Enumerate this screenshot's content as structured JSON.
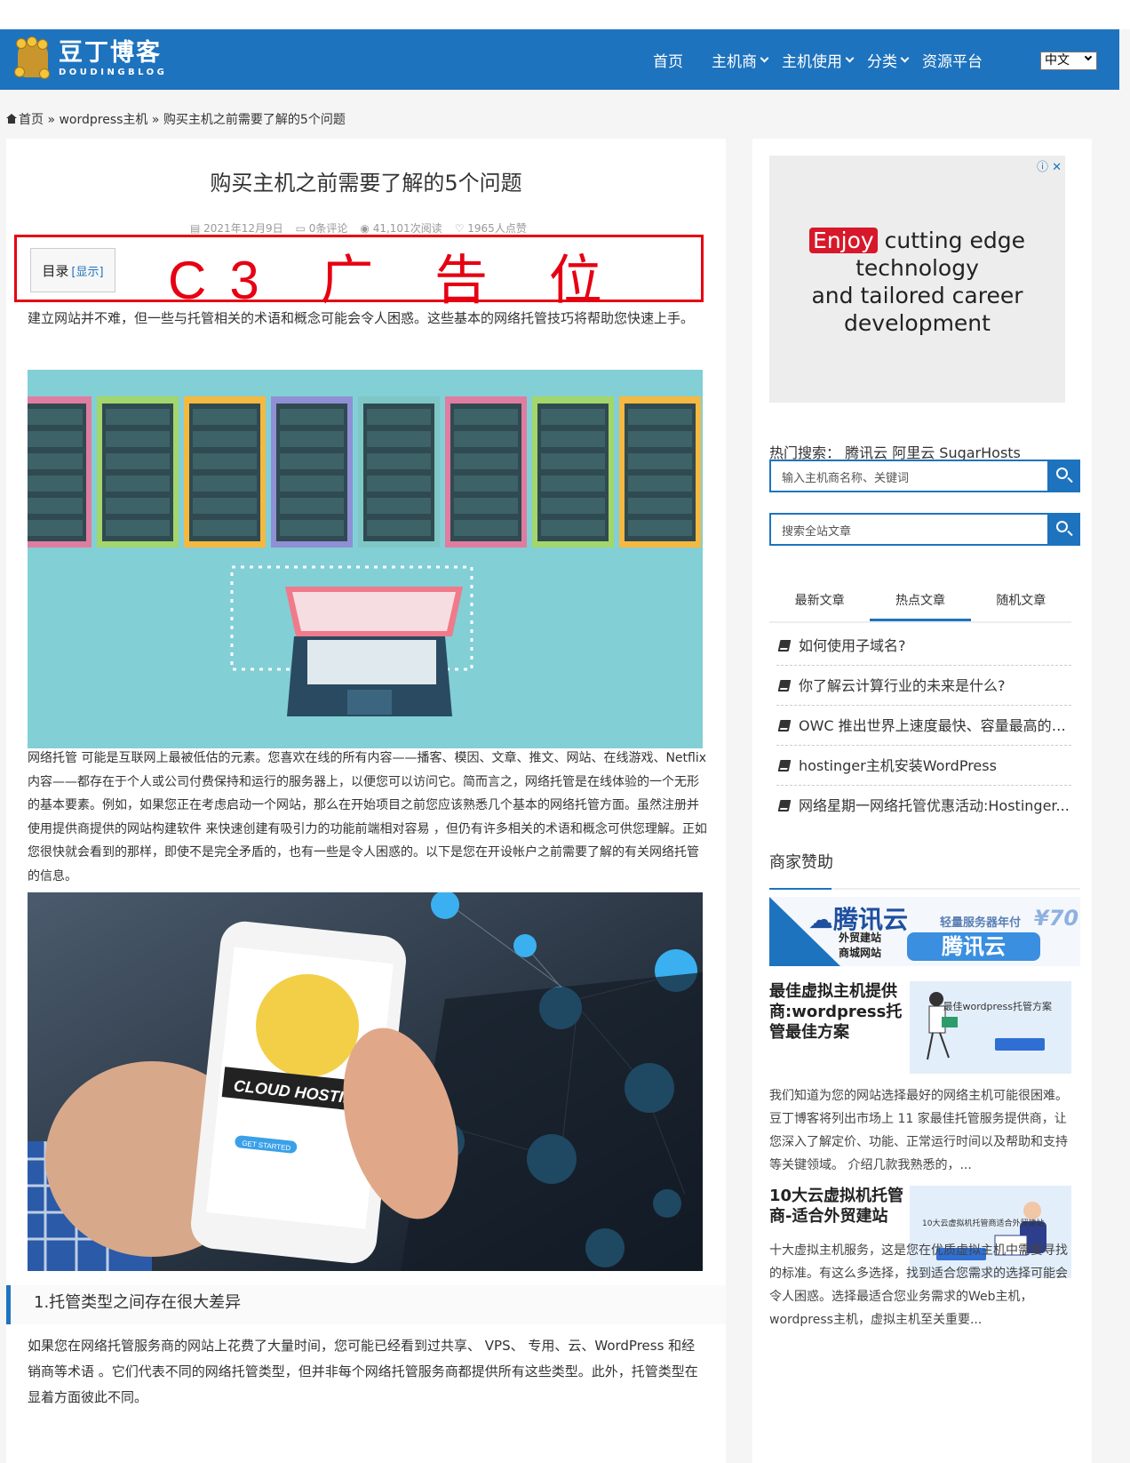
{
  "header": {
    "logo_title": "豆丁博客",
    "logo_sub": "DOUDINGBLOG",
    "nav": [
      {
        "label": "首页",
        "dropdown": false
      },
      {
        "label": "主机商",
        "dropdown": true
      },
      {
        "label": "主机使用",
        "dropdown": true
      },
      {
        "label": "分类",
        "dropdown": true
      },
      {
        "label": "资源平台",
        "dropdown": false
      }
    ],
    "language_selected": "中文"
  },
  "breadcrumb": {
    "home": "首页",
    "sep1": "»",
    "category": "wordpress主机",
    "sep2": "»",
    "current": "购买主机之前需要了解的5个问题"
  },
  "article": {
    "title": "购买主机之前需要了解的5个问题",
    "meta": {
      "date": "2021年12月9日",
      "comments": "0条评论",
      "views": "41,101次阅读",
      "likes": "1965人点赞"
    },
    "toc_label": "目录",
    "toc_toggle": "[显示]",
    "ad_label": "C3 广 告 位",
    "intro": "建立网站并不难，但一些与托管相关的术语和概念可能会令人困惑。这些基本的网络托管技巧将帮助您快速上手。",
    "body_paragraph": "网络托管 可能是互联网上最被低估的元素。您喜欢在线的所有内容——播客、模因、文章、推文、网站、在线游戏、Netflix内容——都存在于个人或公司付费保持和运行的服务器上，以便您可以访问它。简而言之，网络托管是在线体验的一个无形的基本要素。例如，如果您正在考虑启动一个网站，那么在开始项目之前您应该熟悉几个基本的网络托管方面。虽然注册并使用提供商提供的网站构建软件 来快速创建有吸引力的功能前端相对容易 ，但仍有许多相关的术语和概念可供您理解。正如您很快就会看到的那样，即使不是完全矛盾的，也有一些是令人困惑的。以下是您在开设帐户之前需要了解的有关网络托管的信息。",
    "cloud_image_text": "CLOUD HOSTING",
    "cloud_image_button": "GET STARTED",
    "section1_title": "1.托管类型之间存在很大差异",
    "section1_paragraph": "如果您在网络托管服务商的网站上花费了大量时间，您可能已经看到过共享、 VPS、 专用、云、WordPress 和经销商等术语 。它们代表不同的网络托管类型，但并非每个网络托管服务商都提供所有这些类型。此外，托管类型在显着方面彼此不同。"
  },
  "sidebar": {
    "ad": {
      "highlight": "Enjoy",
      "copy_line1": " cutting edge",
      "copy_line2": "technology",
      "copy_line3": "and tailored career",
      "copy_line4": "development",
      "icons": "ⓘ ✕"
    },
    "hot_search_label": "热门搜索：",
    "hot_search_terms": "腾讯云 阿里云 SugarHosts",
    "host_search_placeholder": "输入主机商名称、关键词",
    "site_search_placeholder": "搜索全站文章",
    "tabs": [
      {
        "label": "最新文章",
        "active": false
      },
      {
        "label": "热点文章",
        "active": true
      },
      {
        "label": "随机文章",
        "active": false
      }
    ],
    "hot_articles": [
      "如何使用子域名?",
      "你了解云计算行业的未来是什么?",
      "OWC 推出世界上速度最快、容量最高的P...",
      "hostinger主机安装WordPress",
      "网络星期一网络托管优惠活动:Hostinger..."
    ],
    "sponsor_title": "商家赞助",
    "tencent_banner": {
      "logo": "腾讯云",
      "sub1": "外贸建站",
      "sub2": "商城网站",
      "promo": "轻量服务器年付",
      "price": "¥70",
      "brand": "腾讯云"
    },
    "posts": [
      {
        "title": "最佳虚拟主机提供商:wordpress托管最佳方案",
        "thumb_text": "最佳wordpress托管方案",
        "excerpt": "我们知道为您的网站选择最好的网络主机可能很困难。豆丁博客将列出市场上 11 家最佳托管服务提供商，让您深入了解定价、功能、正常运行时间以及帮助和支持等关键领域。 介绍几款我熟悉的，..."
      },
      {
        "title": "10大云虚拟机托管商-适合外贸建站",
        "thumb_text": "10大云虚拟机托管商适合外贸建站",
        "excerpt": "十大虚拟主机服务，这是您在优质虚拟主机中需要寻找的标准。有这么多选择，找到适合您需求的选择可能会令人困惑。选择最适合您业务需求的Web主机，wordpress主机，虚拟主机至关重要..."
      }
    ]
  },
  "colors": {
    "brand_blue": "#1e73be",
    "ad_red": "#e60012"
  }
}
